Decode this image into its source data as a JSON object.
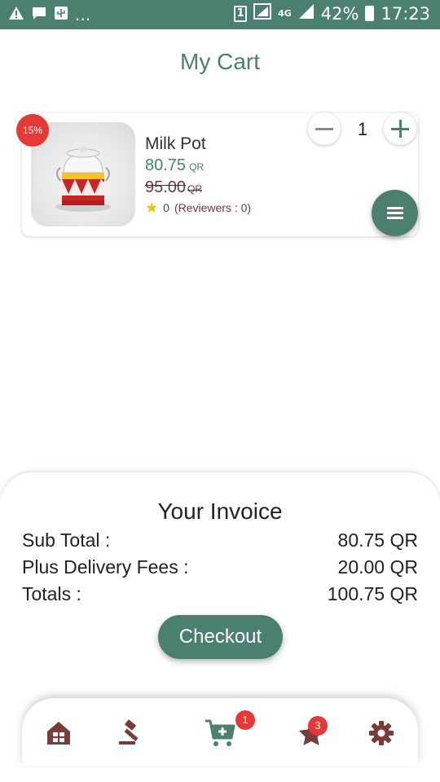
{
  "status_bar": {
    "left_more": "...",
    "sim_label": "1",
    "network_type": "4G",
    "battery": "42%",
    "time": "17:23"
  },
  "page": {
    "title": "My Cart"
  },
  "cart_items": [
    {
      "discount": "15%",
      "name": "Milk Pot",
      "price": "80.75",
      "currency": "QR",
      "old_price": "95.00",
      "old_currency": "QR",
      "rating": "0",
      "reviewers": "(Reviewers : 0)",
      "quantity": "1"
    }
  ],
  "invoice": {
    "title": "Your Invoice",
    "rows": [
      {
        "label": "Sub Total :",
        "value": "80.75 QR"
      },
      {
        "label": "Plus Delivery Fees :",
        "value": "20.00 QR"
      },
      {
        "label": "Totals :",
        "value": "100.75 QR"
      }
    ],
    "checkout_label": "Checkout"
  },
  "bottom_nav": {
    "items": [
      {
        "icon": "home-icon"
      },
      {
        "icon": "gavel-icon"
      },
      {
        "icon": "cart-icon",
        "badge": "1",
        "active": true
      },
      {
        "icon": "favorites-icon",
        "badge": "3"
      },
      {
        "icon": "settings-icon"
      }
    ]
  },
  "colors": {
    "accent": "#4b8070",
    "badge": "#e53935",
    "nav_icon": "#7a3b3b",
    "star": "#f2c200"
  }
}
